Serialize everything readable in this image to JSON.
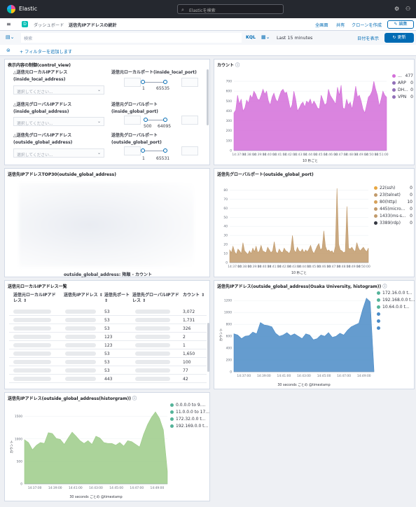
{
  "header": {
    "app_title": "Elastic",
    "search_placeholder": "Elasticを検索"
  },
  "breadcrumbs": {
    "space_initial": "D",
    "items": [
      "ダッシュボード",
      "送信先IPアドレスの統計"
    ]
  },
  "actions": {
    "full_screen": "全画面",
    "share": "共有",
    "clone": "クローンを作成",
    "edit": "編集"
  },
  "query": {
    "placeholder": "検索",
    "language": "KQL",
    "time_range": "Last 15 minutes",
    "show_dates": "日付を表示",
    "update": "更新"
  },
  "filters": {
    "add": "+ フィルターを追加します"
  },
  "panels": {
    "control_view": {
      "title": "表示内容の制御(control_view)",
      "controls": [
        {
          "label_line1": "△送信元ローカルIPアドレス",
          "label_line2": "(inside_local_address)",
          "placeholder": "選択してください..."
        },
        {
          "label_line1": "送信元ローカルポート(inside_local_port)",
          "label_line2": "",
          "min": "1",
          "max": "65535"
        },
        {
          "label_line1": "△送信元グローバルIPアドレス",
          "label_line2": "(inside_global_address)",
          "placeholder": "選択してください..."
        },
        {
          "label_line1": "送信元グローバルポート",
          "label_line2": "(inside_global_port)",
          "min": "500",
          "max": "64095"
        },
        {
          "label_line1": "△送信先グローバルIPアドレス",
          "label_line2": "(outside_global_address)",
          "placeholder": "選択してください..."
        },
        {
          "label_line1": "送信先グローバルポート",
          "label_line2": "(outside_global_port)",
          "min": "1",
          "max": "65531"
        }
      ]
    },
    "count": {
      "title": "カウント",
      "xlabel": "10 秒ごと"
    },
    "top30": {
      "title": "送信先IPアドレスTOP30(outside_global_address)",
      "caption": "outside_global_address: 降順 - カウント"
    },
    "dest_port": {
      "title": "送信先グローバルポート(outside_global_port)",
      "xlabel": "10 秒ごと"
    },
    "local_ip_table": {
      "title": "送信元ローカルIPアドレス一覧",
      "headers": [
        "送信元ローカルIPアドレス ⇕",
        "送信先IPアドレス ⇕",
        "送信先ポート ⇕",
        "送信先グローバルIPアドレス ⇕",
        "カウント ⇕"
      ],
      "rows": [
        {
          "port": "53",
          "count": "3,072"
        },
        {
          "port": "53",
          "count": "1,731"
        },
        {
          "port": "53",
          "count": "326"
        },
        {
          "port": "123",
          "count": "2"
        },
        {
          "port": "123",
          "count": "1"
        },
        {
          "port": "53",
          "count": "1,650"
        },
        {
          "port": "53",
          "count": "100"
        },
        {
          "port": "53",
          "count": "77"
        },
        {
          "port": "443",
          "count": "42"
        }
      ]
    },
    "osaka_hist": {
      "title": "送信先IPアドレス(outside_global_address(Osaka University, histogram))",
      "xlabel": "30 seconds ごとの @timestamp",
      "ylabel": "カウント"
    },
    "hist": {
      "title": "送信先IPアドレス(outside_global_address(historgram))",
      "xlabel": "30 seconds ごとの @timestamp",
      "ylabel": "カウント"
    }
  },
  "chart_data": [
    {
      "type": "area",
      "color": "#d36fd9",
      "x_ticks": [
        "14:37:00",
        "14:38:00",
        "14:39:00",
        "14:40:00",
        "14:41:00",
        "14:42:00",
        "14:43:00",
        "14:44:00",
        "14:45:00",
        "14:46:00",
        "14:47:00",
        "14:48:00",
        "14:49:00",
        "14:50:00",
        "14:51:00"
      ],
      "ylim": [
        0,
        750
      ],
      "y_ticks": [
        0,
        100,
        200,
        300,
        400,
        500,
        600,
        700
      ],
      "values": [
        380,
        410,
        560,
        470,
        520,
        400,
        430,
        510,
        480,
        560,
        530,
        600,
        570,
        520,
        510,
        560,
        620,
        570,
        600,
        500,
        460,
        540,
        580,
        520,
        490,
        550,
        600,
        620,
        580,
        590,
        510,
        420,
        460,
        600,
        520,
        400,
        430,
        470,
        490,
        440,
        500,
        480,
        520,
        460,
        500,
        470,
        430,
        420,
        560,
        510,
        460,
        480,
        620,
        560,
        530,
        500,
        470,
        640,
        560,
        660,
        430,
        420,
        520,
        460,
        490,
        420,
        520,
        650,
        540,
        560,
        500,
        420,
        380,
        460,
        540,
        560,
        600,
        700,
        620,
        560,
        450,
        520,
        600,
        560,
        540
      ],
      "legend": [
        {
          "name": "...",
          "value": "477",
          "color": "#d36fd9"
        },
        {
          "name": "ARP",
          "value": "0",
          "color": "#9170b8"
        },
        {
          "name": "DH...",
          "value": "0",
          "color": "#9170b8"
        },
        {
          "name": "VPN",
          "value": "0",
          "color": "#9170b8"
        }
      ]
    },
    {
      "type": "area",
      "color": "#c19a6b",
      "x_ticks": [
        "14:37:00",
        "14:38:00",
        "14:39:00",
        "14:40:00",
        "14:41:00",
        "14:42:00",
        "14:43:00",
        "14:44:00",
        "14:45:00",
        "14:46:00",
        "14:47:00",
        "14:48:00",
        "14:49:00",
        "14:50:00"
      ],
      "ylim": [
        0,
        85
      ],
      "y_ticks": [
        0,
        10,
        20,
        30,
        40,
        50,
        60,
        70,
        80
      ],
      "values": [
        14,
        11,
        18,
        12,
        9,
        15,
        13,
        10,
        22,
        13,
        11,
        9,
        13,
        10,
        16,
        12,
        18,
        11,
        13,
        19,
        13,
        12,
        11,
        17,
        14,
        11,
        13,
        23,
        12,
        10,
        15,
        12,
        11,
        16,
        13,
        12,
        10,
        14,
        30,
        14,
        11,
        17,
        13,
        12,
        15,
        11,
        14,
        12,
        15,
        19,
        13,
        10,
        14,
        18,
        21,
        14,
        16,
        35,
        18,
        13,
        14,
        12,
        13,
        10,
        18,
        82,
        20,
        14,
        13,
        11,
        12,
        62,
        16,
        15,
        17,
        14,
        12,
        22,
        16,
        13,
        15,
        17,
        14,
        12,
        16
      ],
      "legend": [
        {
          "name": "22(ssh)",
          "value": "0",
          "color": "#e7a742"
        },
        {
          "name": "23(telnet)",
          "value": "0",
          "color": "#c19a6b"
        },
        {
          "name": "80(http)",
          "value": "10",
          "color": "#d6a15b"
        },
        {
          "name": "445(micro...",
          "value": "0",
          "color": "#c19a6b"
        },
        {
          "name": "1433(ms-s...",
          "value": "0",
          "color": "#c19a6b"
        },
        {
          "name": "3389(rdp)",
          "value": "0",
          "color": "#343741"
        }
      ]
    },
    {
      "type": "area",
      "color": "#4a8bc7",
      "x_ticks": [
        "14:37:00",
        "14:39:00",
        "14:41:00",
        "14:43:00",
        "14:45:00",
        "14:47:00",
        "14:49:00"
      ],
      "ylim": [
        0,
        1250
      ],
      "y_ticks": [
        0,
        200,
        400,
        600,
        800,
        1000,
        1200
      ],
      "values": [
        640,
        620,
        560,
        600,
        610,
        670,
        640,
        830,
        790,
        780,
        760,
        650,
        600,
        620,
        660,
        610,
        640,
        600,
        560,
        640,
        620,
        540,
        560,
        620,
        600,
        660,
        580,
        600,
        650,
        620,
        700,
        760,
        790,
        820,
        1050,
        1240,
        1180,
        20
      ],
      "legend": [
        {
          "name": "172.16.0.0 t...",
          "value": "",
          "color": "#54b399"
        },
        {
          "name": "192.168.0.0 t...",
          "value": "",
          "color": "#54b399"
        },
        {
          "name": "10.64.0.0 t...",
          "value": "",
          "color": "#54b399"
        },
        {
          "name": "",
          "value": "",
          "color": "#4a8bc7"
        },
        {
          "name": "",
          "value": "",
          "color": "#4a8bc7"
        },
        {
          "name": "",
          "value": "",
          "color": "#4a8bc7"
        }
      ]
    },
    {
      "type": "area",
      "color": "#9ccb88",
      "x_ticks": [
        "14:37:00",
        "14:39:00",
        "14:41:00",
        "14:43:00",
        "14:45:00",
        "14:47:00",
        "14:49:00"
      ],
      "ylim": [
        0,
        1650
      ],
      "y_ticks": [
        0,
        500,
        1000,
        1500
      ],
      "values": [
        980,
        920,
        760,
        860,
        920,
        900,
        1140,
        1120,
        1010,
        990,
        880,
        1020,
        1150,
        1060,
        960,
        900,
        960,
        880,
        1060,
        1020,
        920,
        900,
        900,
        860,
        920,
        840,
        960,
        940,
        880,
        820,
        1100,
        1320,
        1480,
        1600,
        1460,
        1200,
        280
      ],
      "legend": [
        {
          "name": "0.0.0.0 to 9....",
          "value": "",
          "color": "#54b399"
        },
        {
          "name": "11.0.0.0 to 17...",
          "value": "",
          "color": "#54b399"
        },
        {
          "name": "172.32.0.0 t...",
          "value": "",
          "color": "#54b399"
        },
        {
          "name": "192.169.0.0 t...",
          "value": "",
          "color": "#54b399"
        }
      ]
    }
  ]
}
